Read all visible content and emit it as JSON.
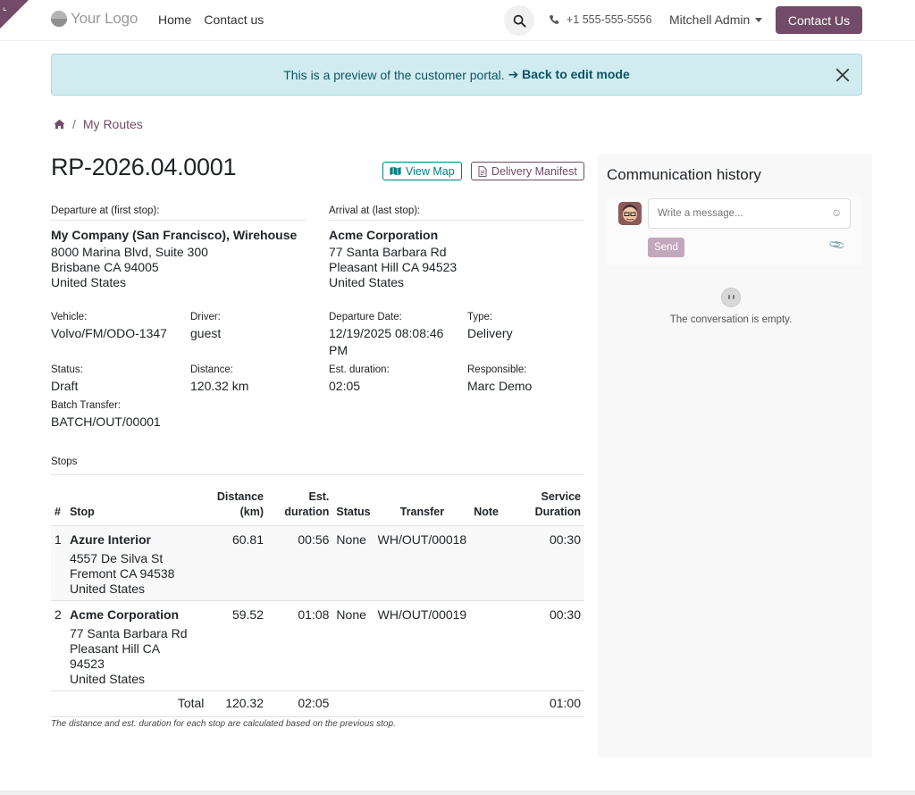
{
  "brand": {
    "logo_text": "Your Logo",
    "accent": "#714b67",
    "link_teal": "#017e84"
  },
  "header": {
    "nav": [
      "Home",
      "Contact us"
    ],
    "phone": "+1 555-555-5556",
    "user": "Mitchell Admin",
    "contact_button": "Contact Us",
    "icons": {
      "search": "search-icon",
      "phone": "phone-icon"
    }
  },
  "alert": {
    "text": "This is a preview of the customer portal.",
    "link": "➔ Back to edit mode"
  },
  "breadcrumb": {
    "current": "My Routes"
  },
  "route": {
    "title": "RP-2026.04.0001",
    "view_map": "View Map",
    "delivery_manifest": "Delivery Manifest",
    "departure": {
      "label": "Departure at (first stop):",
      "name": "My Company (San Francisco), Wirehouse",
      "lines": [
        "8000 Marina Blvd, Suite 300",
        "Brisbane CA 94005",
        "United States"
      ]
    },
    "arrival": {
      "label": "Arrival at (last stop):",
      "name": "Acme Corporation",
      "lines": [
        "77 Santa Barbara Rd",
        "Pleasant Hill CA 94523",
        "United States"
      ]
    },
    "fields": {
      "vehicle": {
        "label": "Vehicle:",
        "value": "Volvo/FM/ODO-1347"
      },
      "driver": {
        "label": "Driver:",
        "value": "guest"
      },
      "departure_date": {
        "label": "Departure Date:",
        "value": "12/19/2025 08:08:46 PM"
      },
      "type": {
        "label": "Type:",
        "value": "Delivery"
      },
      "status": {
        "label": "Status:",
        "value": "Draft"
      },
      "distance": {
        "label": "Distance:",
        "value": "120.32 km"
      },
      "est_duration": {
        "label": "Est. duration:",
        "value": "02:05"
      },
      "responsible": {
        "label": "Responsible:",
        "value": "Marc Demo"
      },
      "batch": {
        "label": "Batch Transfer:",
        "value": "BATCH/OUT/00001"
      }
    }
  },
  "stops": {
    "label": "Stops",
    "headers": {
      "num": "#",
      "stop": "Stop",
      "distance_1": "Distance",
      "distance_2": "(km)",
      "est_1": "Est.",
      "est_2": "duration",
      "status": "Status",
      "transfer": "Transfer",
      "note": "Note",
      "service_1": "Service",
      "service_2": "Duration"
    },
    "rows": [
      {
        "num": "1",
        "name": "Azure Interior",
        "lines": [
          "4557 De Silva St",
          "Fremont CA 94538",
          "United States"
        ],
        "distance": "60.81",
        "duration": "00:56",
        "status": "None",
        "transfer": "WH/OUT/00018",
        "note": "",
        "service": "00:30"
      },
      {
        "num": "2",
        "name": "Acme Corporation",
        "lines": [
          "77 Santa Barbara Rd",
          "Pleasant Hill CA",
          "94523",
          "United States"
        ],
        "distance": "59.52",
        "duration": "01:08",
        "status": "None",
        "transfer": "WH/OUT/00019",
        "note": "",
        "service": "00:30"
      }
    ],
    "total": {
      "label": "Total",
      "distance": "120.32",
      "duration": "02:05",
      "service": "01:00"
    },
    "footnote": "The distance and est. duration for each stop are calculated based on the previous stop."
  },
  "communication": {
    "title": "Communication history",
    "placeholder": "Write a message...",
    "send": "Send",
    "empty": "The conversation is empty."
  }
}
